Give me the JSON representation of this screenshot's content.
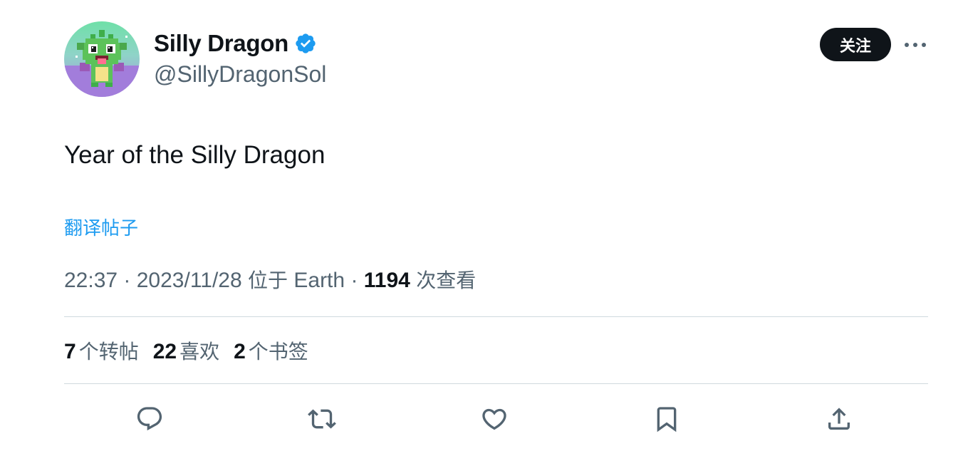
{
  "author": {
    "name": "Silly Dragon",
    "handle": "@SillyDragonSol",
    "verified_color": "#1d9bf0"
  },
  "follow_label": "关注",
  "more_icon": "more-horizontal-icon",
  "tweet": {
    "text": "Year of the Silly Dragon",
    "translate_label": "翻译帖子"
  },
  "meta": {
    "time": "22:37",
    "date": "2023/11/28",
    "location_prefix": "位于",
    "location": "Earth",
    "views": "1194",
    "views_label": "次查看"
  },
  "stats": {
    "reposts_count": "7",
    "reposts_label": "个转帖",
    "likes_count": "22",
    "likes_label": "喜欢",
    "bookmarks_count": "2",
    "bookmarks_label": "个书签"
  },
  "actions": [
    "reply-icon",
    "repost-icon",
    "like-icon",
    "bookmark-icon",
    "share-icon"
  ],
  "colors": {
    "text": "#0f1419",
    "secondary": "#536471",
    "accent": "#1d9bf0",
    "divider": "#cfd9de"
  }
}
